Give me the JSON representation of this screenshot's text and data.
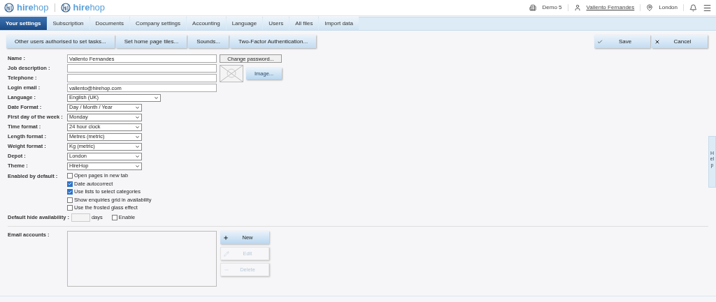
{
  "header": {
    "logos": [
      "**hire**hop",
      "**hire**hop"
    ],
    "company": "Demo 5",
    "user": "Vallento Fernandes",
    "depot": "London"
  },
  "tabs": [
    {
      "label": "Your settings",
      "selected": true
    },
    {
      "label": "Subscription",
      "selected": false
    },
    {
      "label": "Documents",
      "selected": false
    },
    {
      "label": "Company settings",
      "selected": false
    },
    {
      "label": "Accounting",
      "selected": false
    },
    {
      "label": "Language",
      "selected": false
    },
    {
      "label": "Users",
      "selected": false
    },
    {
      "label": "All files",
      "selected": false
    },
    {
      "label": "Import data",
      "selected": false
    }
  ],
  "toolbar": {
    "buttons": [
      "Other users authorised to set tasks...",
      "Set home page tiles...",
      "Sounds...",
      "Two-Factor Authentication..."
    ],
    "save": "Save",
    "cancel": "Cancel"
  },
  "fields": [
    {
      "label": "Name :",
      "kind": "text",
      "value": "Vallento Fernandes"
    },
    {
      "label": "Job description :",
      "kind": "text"
    },
    {
      "label": "Telephone :",
      "kind": "text"
    },
    {
      "label": "Login email :",
      "kind": "text",
      "value": "vallento@hirehop.com"
    },
    {
      "label": "Language :",
      "kind": "select",
      "wide": true,
      "value": "English (UK)"
    },
    {
      "label": "Date Format :",
      "kind": "select",
      "wide": false,
      "value": "Day / Month / Year"
    },
    {
      "label": "First day of the week :",
      "kind": "select",
      "wide": false,
      "value": "Monday"
    },
    {
      "label": "Time format :",
      "kind": "select",
      "wide": false,
      "value": "24 hour clock"
    },
    {
      "label": "Length format :",
      "kind": "select",
      "wide": false,
      "value": "Metres (metric)"
    },
    {
      "label": "Weight format :",
      "kind": "select",
      "wide": false,
      "value": "Kg (metric)"
    },
    {
      "label": "Depot :",
      "kind": "select",
      "wide": false,
      "value": "London"
    },
    {
      "label": "Theme :",
      "kind": "select",
      "wide": false,
      "value": "HireHop"
    }
  ],
  "change_password": "Change password...",
  "image_button": "Image...",
  "enabled_by_default": {
    "label": "Enabled by default :",
    "options": [
      {
        "label": "Open pages in new tab",
        "checked": false
      },
      {
        "label": "Date autocorrect",
        "checked": true
      },
      {
        "label": "Use lists to select categories",
        "checked": true
      },
      {
        "label": "Show enquiries grid in availability",
        "checked": false
      },
      {
        "label": "Use the frosted glass effect",
        "checked": false
      }
    ]
  },
  "hide_availability": {
    "label": "Default hide availability :",
    "unit": "days",
    "enable": {
      "label": "Enable",
      "checked": false
    }
  },
  "email_accounts": {
    "label": "Email accounts :",
    "buttons": [
      {
        "label": "New",
        "kind": "new",
        "disabled": false
      },
      {
        "label": "Edit",
        "kind": "edit",
        "disabled": true
      },
      {
        "label": "Delete",
        "kind": "delete",
        "disabled": true
      }
    ]
  },
  "help_tab": "Help"
}
